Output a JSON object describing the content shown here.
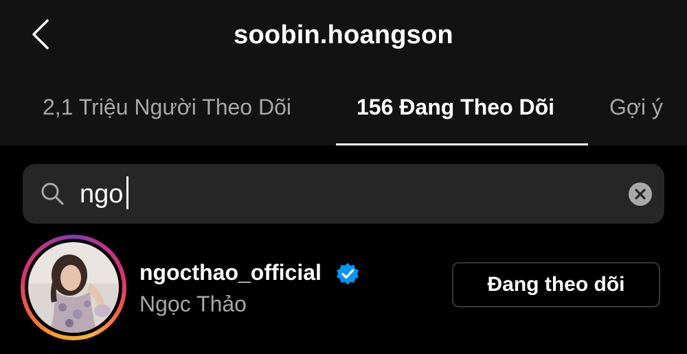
{
  "header": {
    "title": "soobin.hoangson",
    "back_icon": "chevron-left-icon"
  },
  "tabs": [
    {
      "label": "2,1 Triệu Người Theo Dõi",
      "active": false
    },
    {
      "label": "156 Đang Theo Dõi",
      "active": true
    },
    {
      "label": "Gợi ý",
      "active": false
    }
  ],
  "search": {
    "value": "ngo",
    "icon": "search-icon",
    "clear_icon": "clear-icon"
  },
  "results": [
    {
      "username": "ngocthao_official",
      "full_name": "Ngọc Thảo",
      "verified": true,
      "follow_button_label": "Đang theo dõi"
    }
  ],
  "colors": {
    "background": "#000000",
    "header_background": "#121212",
    "search_background": "#262626",
    "secondary_text": "#a8a8a8",
    "verified_blue": "#0095f6",
    "button_border": "#363636"
  }
}
